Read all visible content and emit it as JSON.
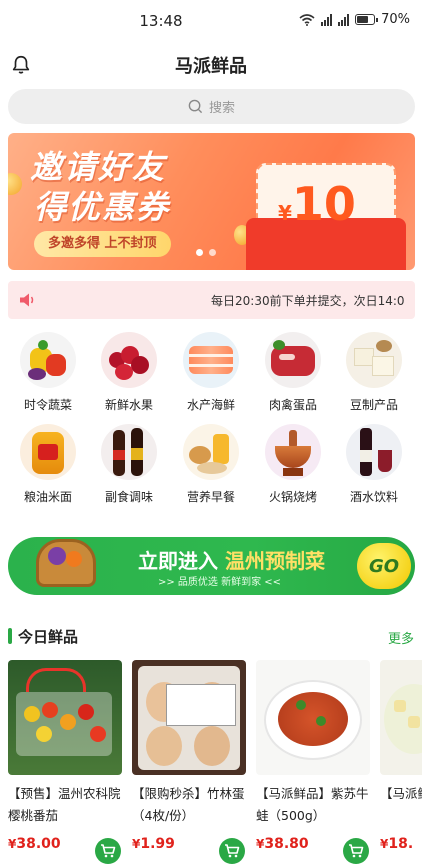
{
  "status_bar": {
    "time": "13:48",
    "battery": "70%",
    "network_1": "4G",
    "network_2": "5G"
  },
  "header": {
    "title": "马派鲜品"
  },
  "search": {
    "placeholder": "搜索"
  },
  "banner": {
    "title_line1": "邀请好友",
    "title_line2": "得优惠券",
    "subtitle": "多邀多得 上不封顶",
    "currency": "¥",
    "amount": "10"
  },
  "notice": {
    "text": "每日20:30前下单并提交，次日14:0"
  },
  "categories": [
    {
      "label": "时令蔬菜",
      "icon": "vegetables-icon"
    },
    {
      "label": "新鲜水果",
      "icon": "fruit-icon"
    },
    {
      "label": "水产海鲜",
      "icon": "seafood-icon"
    },
    {
      "label": "肉禽蛋品",
      "icon": "meat-icon"
    },
    {
      "label": "豆制产品",
      "icon": "tofu-icon"
    },
    {
      "label": "粮油米面",
      "icon": "oil-grain-icon"
    },
    {
      "label": "副食调味",
      "icon": "seasoning-icon"
    },
    {
      "label": "营养早餐",
      "icon": "breakfast-icon"
    },
    {
      "label": "火锅烧烤",
      "icon": "hotpot-icon"
    },
    {
      "label": "酒水饮料",
      "icon": "drinks-icon"
    }
  ],
  "promo": {
    "title_prefix": "立即进入",
    "title_highlight": "温州预制菜",
    "subtitle": ">> 品质优选  新鲜到家 <<",
    "go_label": "GO"
  },
  "section": {
    "title": "今日鲜品",
    "more": "更多"
  },
  "products": [
    {
      "name": "【预售】温州农科院樱桃番茄",
      "currency": "¥",
      "price": "38.00"
    },
    {
      "name": "【限购秒杀】竹林蛋（4枚/份）",
      "currency": "¥",
      "price": "1.99"
    },
    {
      "name": "【马派鲜品】紫苏牛蛙（500g）",
      "currency": "¥",
      "price": "38.80"
    },
    {
      "name": "【马派鲜品】烩玉子",
      "currency": "¥",
      "price": "18."
    }
  ],
  "colors": {
    "brand_green": "#2aa845",
    "price_red": "#e0221c",
    "banner_orange": "#ff8e5c"
  }
}
